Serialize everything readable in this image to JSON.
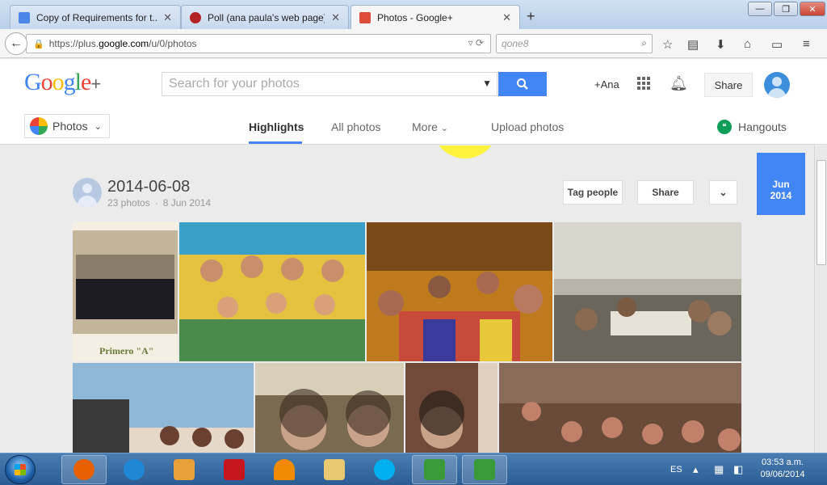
{
  "browser": {
    "tabs": [
      {
        "label": "Copy of Requirements for t...",
        "icon_color": "#4a86e8"
      },
      {
        "label": "Poll (ana paula's web page)",
        "icon_color": "#b22222"
      },
      {
        "label": "Photos - Google+",
        "icon_color": "#dd4b39"
      }
    ],
    "new_tab": "+",
    "window_controls": {
      "minimize": "—",
      "restore": "❐",
      "close": "✕"
    },
    "url": "https://plus.google.com/u/0/photos",
    "url_prefix": "https://plus.",
    "url_domain": "google.com",
    "url_path": "/u/0/photos",
    "search_value": "qone8"
  },
  "gplus": {
    "logo_letters": [
      "G",
      "o",
      "o",
      "g",
      "l",
      "e"
    ],
    "logo_plus": "+",
    "search_placeholder": "Search for your photos",
    "user_link": "+Ana",
    "share_label": "Share"
  },
  "subnav": {
    "photos_dropdown": "Photos",
    "tabs": [
      "Highlights",
      "All photos",
      "More",
      "Upload photos"
    ],
    "active_tab": "Highlights",
    "hangouts_label": "Hangouts"
  },
  "album": {
    "title": "2014-06-08",
    "count": "23 photos",
    "date": "8 Jun 2014",
    "tag_people_label": "Tag people",
    "share_label": "Share",
    "badge_month": "Jun",
    "badge_year": "2014",
    "photos": [
      {
        "caption": "Primero \"A\"",
        "colors": [
          "#f4efe2",
          "#1c1c22",
          "#c2b59a"
        ]
      },
      {
        "caption": "",
        "colors": [
          "#e4c240",
          "#d05a44",
          "#3aa0c8"
        ]
      },
      {
        "caption": "",
        "colors": [
          "#c07a1e",
          "#3d2a1a",
          "#c84a3a"
        ]
      },
      {
        "caption": "",
        "colors": [
          "#b8b4a8",
          "#3f3a33",
          "#d8d5cc"
        ]
      },
      {
        "caption": "",
        "colors": [
          "#8fb8d8",
          "#6a4030",
          "#e6d8c8"
        ]
      },
      {
        "caption": "",
        "colors": [
          "#7a6a50",
          "#3a2a1e",
          "#c9a28a"
        ]
      },
      {
        "caption": "",
        "colors": [
          "#3a2a22",
          "#a86a50",
          "#e0d0c0"
        ]
      },
      {
        "caption": "",
        "colors": [
          "#6a4a38",
          "#c0806a",
          "#2a1e18"
        ]
      }
    ]
  },
  "taskbar": {
    "language": "ES",
    "time": "03:53 a.m.",
    "date": "09/06/2014",
    "apps": [
      {
        "name": "firefox",
        "color": "#e66000",
        "active": true
      },
      {
        "name": "internet-explorer",
        "color": "#1e88d6",
        "active": false
      },
      {
        "name": "media-player",
        "color": "#e8a03a",
        "active": false
      },
      {
        "name": "acrobat",
        "color": "#c4161c",
        "active": false
      },
      {
        "name": "vlc",
        "color": "#f08a00",
        "active": false
      },
      {
        "name": "explorer",
        "color": "#e8c870",
        "active": false
      },
      {
        "name": "skype",
        "color": "#00aff0",
        "active": false
      },
      {
        "name": "camtasia-1",
        "color": "#3a9a3a",
        "active": true
      },
      {
        "name": "camtasia-2",
        "color": "#3a9a3a",
        "active": true
      }
    ]
  }
}
